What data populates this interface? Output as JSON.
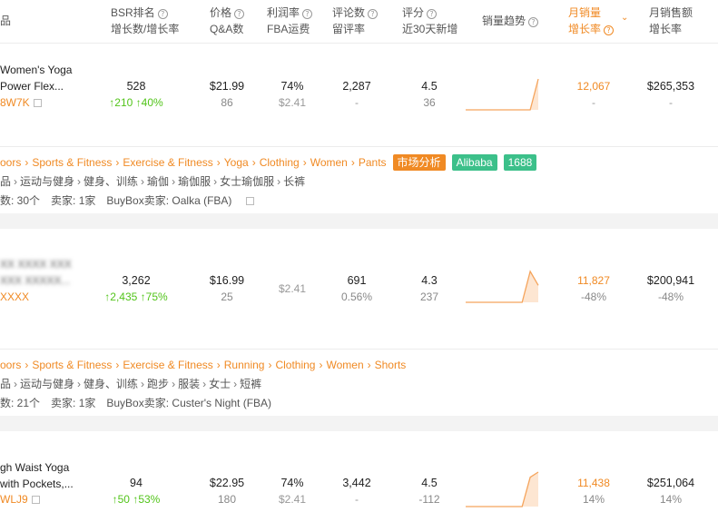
{
  "header": {
    "col_product": "品",
    "bsr_l1": "BSR排名",
    "bsr_l2": "增长数/增长率",
    "price_l1": "价格",
    "price_l2": "Q&A数",
    "profit_l1": "利润率",
    "profit_l2": "FBA运费",
    "reviews_l1": "评论数",
    "reviews_l2": "留评率",
    "rating_l1": "评分",
    "rating_l2": "近30天新增",
    "trend_l1": "销量趋势",
    "msales_l1": "月销量",
    "msales_l2": "增长率",
    "mrev_l1": "月销售额",
    "mrev_l2": "增长率",
    "help_glyph": "?",
    "sort_glyph": "⌄"
  },
  "products": [
    {
      "title_l1": "Women's Yoga",
      "title_l2": "Power Flex...",
      "asin": "8W7K",
      "bsr": "528",
      "bsr_growth": "↑210",
      "bsr_rate": "↑40%",
      "price": "$21.99",
      "qa": "86",
      "profit": "74%",
      "fba": "$2.41",
      "reviews": "2,287",
      "review_rate": "-",
      "rating": "4.5",
      "rating_new": "36",
      "msales": "12,067",
      "msales_rate": "-",
      "mrev": "$265,353",
      "mrev_rate": "-",
      "trend": [
        0,
        0,
        0,
        0,
        0,
        0,
        0,
        0,
        0,
        1
      ]
    },
    {
      "title_l1": "XX XXXX XXX",
      "title_l2": "XXX XXXXX...",
      "asin": "XXXX",
      "bsr": "3,262",
      "bsr_growth": "↑2,435",
      "bsr_rate": "↑75%",
      "price": "$16.99",
      "qa": "25",
      "profit": "",
      "fba": "$2.41",
      "reviews": "691",
      "review_rate": "0.56%",
      "rating": "4.3",
      "rating_new": "237",
      "msales": "11,827",
      "msales_rate": "-48%",
      "mrev": "$200,941",
      "mrev_rate": "-48%",
      "trend": [
        0,
        0,
        0,
        0,
        0,
        0,
        0,
        0,
        1,
        0.55
      ]
    },
    {
      "title_l1": "gh Waist Yoga",
      "title_l2": "with Pockets,...",
      "asin": "WLJ9",
      "bsr": "94",
      "bsr_growth": "↑50",
      "bsr_rate": "↑53%",
      "price": "$22.95",
      "qa": "180",
      "profit": "74%",
      "fba": "$2.41",
      "reviews": "3,442",
      "review_rate": "-",
      "rating": "4.5",
      "rating_new": "-112",
      "msales": "11,438",
      "msales_rate": "14%",
      "mrev": "$251,064",
      "mrev_rate": "14%",
      "trend": [
        0,
        0,
        0,
        0,
        0,
        0,
        0,
        0,
        0.85,
        1
      ]
    }
  ],
  "details": [
    {
      "crumbs": [
        "oors",
        "Sports & Fitness",
        "Exercise & Fitness",
        "Yoga",
        "Clothing",
        "Women",
        "Pants"
      ],
      "crumb_sep": "›",
      "tags": [
        "市场分析",
        "Alibaba",
        "1688"
      ],
      "cn_crumbs": [
        "品",
        "运动与健身",
        "健身、训练",
        "瑜伽",
        "瑜伽服",
        "女士瑜伽服",
        "长裤"
      ],
      "variants": "数: 30个",
      "sellers": "卖家: 1家",
      "buybox": "BuyBox卖家: Oalka (FBA)"
    },
    {
      "crumbs": [
        "oors",
        "Sports & Fitness",
        "Exercise & Fitness",
        "Running",
        "Clothing",
        "Women",
        "Shorts"
      ],
      "crumb_sep": "›",
      "tags": [],
      "cn_crumbs": [
        "品",
        "运动与健身",
        "健身、训练",
        "跑步",
        "服装",
        "女士",
        "短裤"
      ],
      "variants": "数: 21个",
      "sellers": "卖家: 1家",
      "buybox": "BuyBox卖家: Custer's Night (FBA)"
    }
  ],
  "colors": {
    "accent": "#f08a24",
    "green": "#52c41a",
    "tag_green": "#3cc08a",
    "sparkline": "#f5a45c"
  }
}
